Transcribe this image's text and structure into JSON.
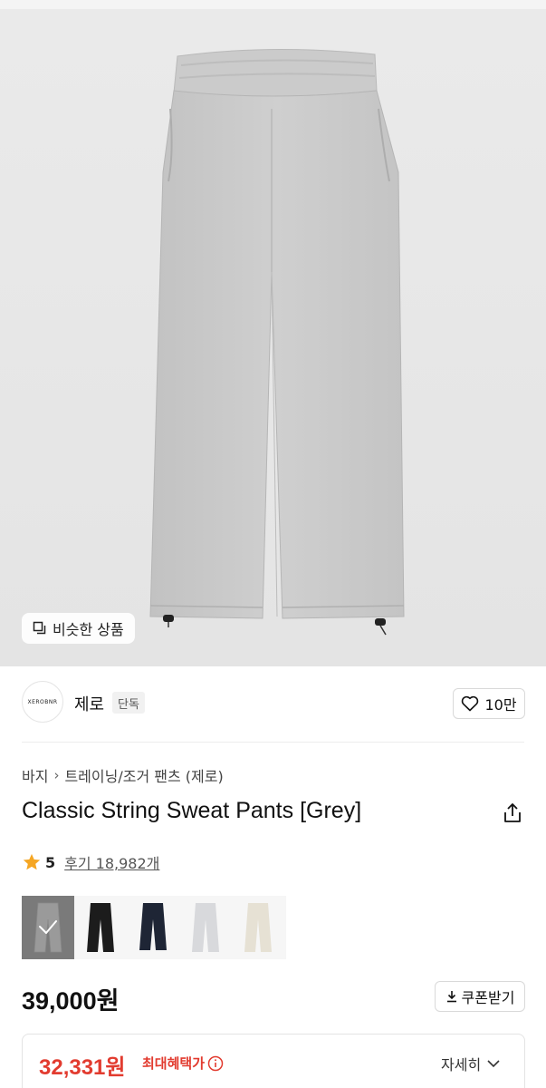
{
  "hero": {
    "similar_button_label": "비슷한 상품"
  },
  "brand": {
    "logo_text": "XEROBNR",
    "name": "제로",
    "badge": "단독",
    "like_count": "10만"
  },
  "breadcrumb": {
    "items": [
      "바지",
      "트레이닝/조거 팬츠 (제로)"
    ]
  },
  "product": {
    "title": "Classic String Sweat Pants [Grey]",
    "rating": "5",
    "reviews_label": "후기 18,982개",
    "colors": [
      {
        "name": "grey",
        "hex": "#9a9a9a",
        "selected": true
      },
      {
        "name": "black",
        "hex": "#1c1c1c",
        "selected": false
      },
      {
        "name": "navy",
        "hex": "#1e2535",
        "selected": false
      },
      {
        "name": "light-grey",
        "hex": "#d8d9dc",
        "selected": false
      },
      {
        "name": "cream",
        "hex": "#e6e1d4",
        "selected": false
      }
    ],
    "price": "39,000원",
    "coupon_label": "쿠폰받기"
  },
  "benefit": {
    "price": "32,331원",
    "label": "최대혜택가",
    "detail_label": "자세히"
  },
  "colors": {
    "accent_red": "#e23b2f",
    "star": "#f5a623"
  }
}
